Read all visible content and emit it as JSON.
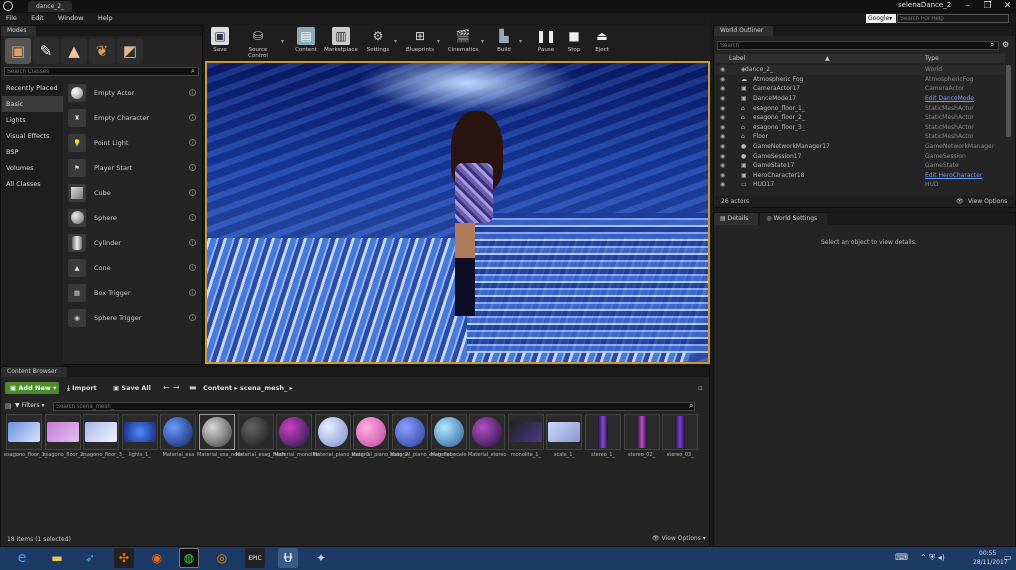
{
  "window": {
    "tab_title": "dance_2_",
    "user": "selenaDance_2",
    "search_help_placeholder": "Search For Help",
    "search_provider": "Google"
  },
  "menu": [
    "File",
    "Edit",
    "Window",
    "Help"
  ],
  "modes": {
    "tab": "Modes",
    "search_placeholder": "Search Classes",
    "categories": [
      "Recently Placed",
      "Basic",
      "Lights",
      "Visual Effects",
      "BSP",
      "Volumes",
      "All Classes"
    ],
    "classes": [
      "Empty Actor",
      "Empty Character",
      "Point Light",
      "Player Start",
      "Cube",
      "Sphere",
      "Cylinder",
      "Cone",
      "Box Trigger",
      "Sphere Trigger"
    ]
  },
  "toolbar": [
    "Save",
    "Source Control",
    "Content",
    "Marketplace",
    "Settings",
    "Blueprints",
    "Cinematics",
    "Build",
    "Pause",
    "Stop",
    "Eject"
  ],
  "outliner": {
    "tab": "World Outliner",
    "search_placeholder": "Search",
    "col_label": "Label",
    "col_type": "Type",
    "rows": [
      {
        "label": "dance_2_",
        "type": "World",
        "link": false
      },
      {
        "label": "Atmospheric Fog",
        "type": "AtmosphericFog",
        "link": false
      },
      {
        "label": "CameraActor17",
        "type": "CameraActor",
        "link": false
      },
      {
        "label": "DanceMode17",
        "type": "Edit DanceMode",
        "link": true
      },
      {
        "label": "esagono_floor_1_",
        "type": "StaticMeshActor",
        "link": false
      },
      {
        "label": "esagono_floor_2_",
        "type": "StaticMeshActor",
        "link": false
      },
      {
        "label": "esagono_floor_3_",
        "type": "StaticMeshActor",
        "link": false
      },
      {
        "label": "Floor",
        "type": "StaticMeshActor",
        "link": false
      },
      {
        "label": "GameNetworkManager17",
        "type": "GameNetworkManager",
        "link": false
      },
      {
        "label": "GameSession17",
        "type": "GameSession",
        "link": false
      },
      {
        "label": "GameState17",
        "type": "GameState",
        "link": false
      },
      {
        "label": "HeroCharacter18",
        "type": "Edit HeroCharacter",
        "link": true
      },
      {
        "label": "HUD17",
        "type": "HUD",
        "link": false
      }
    ],
    "count": "26 actors",
    "view_options": "View Options"
  },
  "details": {
    "tab": "Details",
    "tab2": "World Settings",
    "empty": "Select an object to view details."
  },
  "content_browser": {
    "tab": "Content Browser",
    "add_new": "Add New",
    "import": "Import",
    "save_all": "Save All",
    "path": [
      "Content",
      "scena_mesh_"
    ],
    "filters": "Filters",
    "search_placeholder": "Search scena_mesh_",
    "items": [
      "esagono_floor_1_",
      "esagono_floor_2_",
      "esagono_floor_3_",
      "lights_1_",
      "Material_esa",
      "Material_esa_nder",
      "Material_esag_fresh_",
      "Material_monolite",
      "Material_piano_esag_1_",
      "Material_piano_esag_2_",
      "Material_piano_esag_floor",
      "Material_scale",
      "Material_stereo",
      "monolite_1_",
      "scale_1_",
      "stereo_1_",
      "stereo_02_",
      "stereo_03_"
    ],
    "status": "18 items (1 selected)",
    "view_options": "View Options"
  },
  "taskbar": {
    "time": "00:55",
    "date": "28/11/2017"
  }
}
